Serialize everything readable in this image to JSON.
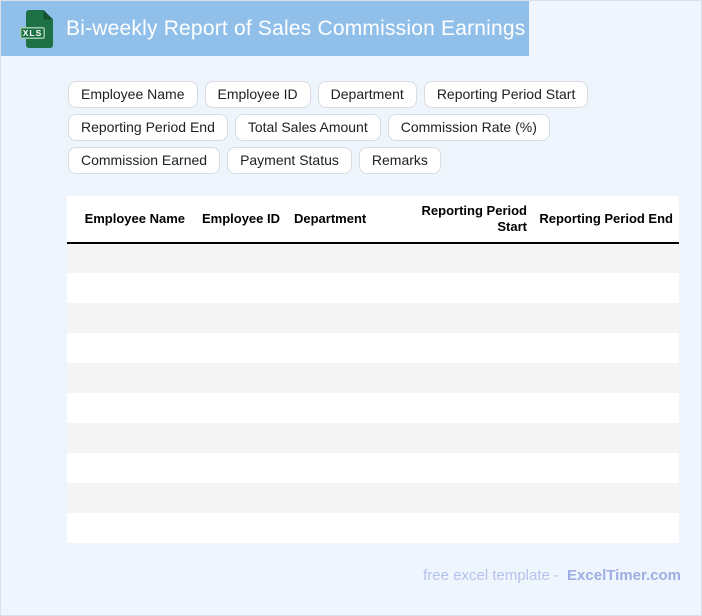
{
  "header": {
    "title": "Bi-weekly Report of Sales Commission Earnings",
    "file_icon_label": "XLS"
  },
  "field_chips": [
    "Employee Name",
    "Employee ID",
    "Department",
    "Reporting Period Start",
    "Reporting Period End",
    "Total Sales Amount",
    "Commission Rate (%)",
    "Commission Earned",
    "Payment Status",
    "Remarks"
  ],
  "table": {
    "columns": [
      "Employee Name",
      "Employee ID",
      "Department",
      "Reporting Period Start",
      "Reporting Period End"
    ],
    "row_count": 10
  },
  "footer": {
    "text": "free excel template -",
    "brand": "ExcelTimer.com"
  },
  "colors": {
    "header_bar": "#90BFEA",
    "page_bg": "#EFF5FD",
    "page_border": "#D9E1EC",
    "row_stripe": "#F5F5F5",
    "chip_border": "#DADCE0",
    "icon_green": "#1E7145",
    "icon_green_dark": "#14512F",
    "icon_banner_border": "#9CC8AE",
    "footer_text": "#B5C2ED",
    "footer_brand": "#9DAEE4"
  }
}
